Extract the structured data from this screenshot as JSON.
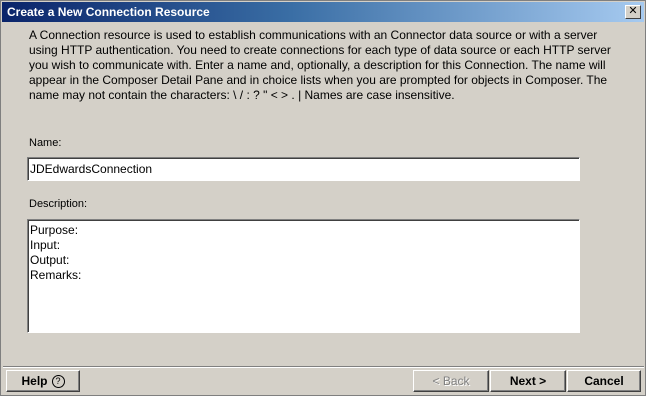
{
  "window": {
    "title": "Create a New Connection Resource",
    "close_glyph": "✕"
  },
  "intro": {
    "text": "A Connection resource is used to establish communications with an Connector data source or with a server using HTTP authentication. You need to create connections for each type of data source or each HTTP server you wish to communicate with.  Enter a name and, optionally, a description for this Connection.  The name will appear in the Composer Detail Pane and in choice lists when you are prompted for objects in Composer.  The name may not contain the characters: \\ / : ? \" < > . |  Names are case insensitive."
  },
  "form": {
    "name_label": "Name:",
    "name_value": "JDEdwardsConnection",
    "description_label": "Description:",
    "description_value": "Purpose:\nInput:\nOutput:\nRemarks:"
  },
  "buttons": {
    "help_label": "Help",
    "help_icon": "?",
    "back_label": "< Back",
    "next_label": "Next >",
    "cancel_label": "Cancel"
  }
}
